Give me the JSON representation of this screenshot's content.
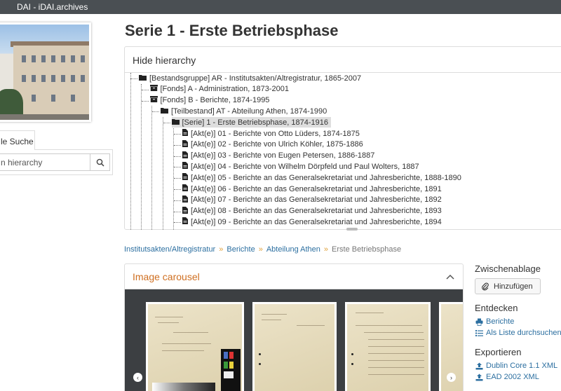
{
  "app": {
    "title": "DAI - iDAI.archives"
  },
  "sidebar": {
    "tab_label": "le Suche",
    "search_placeholder": "n hierarchy"
  },
  "page_title": "Serie 1 - Erste Betriebsphase",
  "hierarchy": {
    "toggle_label": "Hide hierarchy",
    "nodes": [
      {
        "label": "[Bestandsgruppe] AR - Institutsakten/Altregistratur, 1865-2007",
        "icon": "folder-icon",
        "level": 0
      },
      {
        "label": "[Fonds] A - Administration, 1873-2001",
        "icon": "archive-box-icon",
        "level": 1
      },
      {
        "label": "[Fonds] B - Berichte, 1874-1995",
        "icon": "archive-box-icon",
        "level": 1
      },
      {
        "label": "[Teilbestand] AT - Abteilung Athen, 1874-1990",
        "icon": "folder-icon",
        "level": 2
      },
      {
        "label": "[Serie] 1 - Erste Betriebsphase, 1874-1916",
        "icon": "folder-icon",
        "level": 3,
        "current": true
      },
      {
        "label": "[Akt(e)] 01 - Berichte von Otto Lüders, 1874-1875",
        "icon": "file-icon",
        "level": 4
      },
      {
        "label": "[Akt(e)] 02 - Berichte von Ulrich Köhler, 1875-1886",
        "icon": "file-icon",
        "level": 4
      },
      {
        "label": "[Akt(e)] 03 - Berichte von Eugen Petersen, 1886-1887",
        "icon": "file-icon",
        "level": 4
      },
      {
        "label": "[Akt(e)] 04 - Berichte von Wilhelm Dörpfeld und Paul Wolters, 1887",
        "icon": "file-icon",
        "level": 4
      },
      {
        "label": "[Akt(e)] 05 - Berichte an das Generalsekretariat und Jahresberichte, 1888-1890",
        "icon": "file-icon",
        "level": 4
      },
      {
        "label": "[Akt(e)] 06 - Berichte an das Generalsekretariat und Jahresberichte, 1891",
        "icon": "file-icon",
        "level": 4
      },
      {
        "label": "[Akt(e)] 07 - Berichte an das Generalsekretariat und Jahresberichte, 1892",
        "icon": "file-icon",
        "level": 4
      },
      {
        "label": "[Akt(e)] 08 - Berichte an das Generalsekretariat und Jahresberichte, 1893",
        "icon": "file-icon",
        "level": 4
      },
      {
        "label": "[Akt(e)] 09 - Berichte an das Generalsekretariat und Jahresberichte, 1894",
        "icon": "file-icon",
        "level": 4
      }
    ]
  },
  "breadcrumb": {
    "items": [
      "Institutsakten/Altregistratur",
      "Berichte",
      "Abteilung Athen"
    ],
    "current": "Erste Betriebsphase",
    "separator": "»"
  },
  "carousel": {
    "title": "Image carousel",
    "prev_label": "‹",
    "next_label": "›"
  },
  "right": {
    "clipboard_heading": "Zwischenablage",
    "add_button": "Hinzufügen",
    "discover_heading": "Entdecken",
    "discover_links": [
      "Berichte",
      "Als Liste durchsuchen"
    ],
    "export_heading": "Exportieren",
    "export_links": [
      "Dublin Core 1.1 XML",
      "EAD 2002 XML"
    ]
  },
  "colors": {
    "topbar": "#4a4f53",
    "link": "#2c6fa0",
    "accent_orange": "#cf6f21",
    "carousel_bg": "#3c3f42"
  }
}
